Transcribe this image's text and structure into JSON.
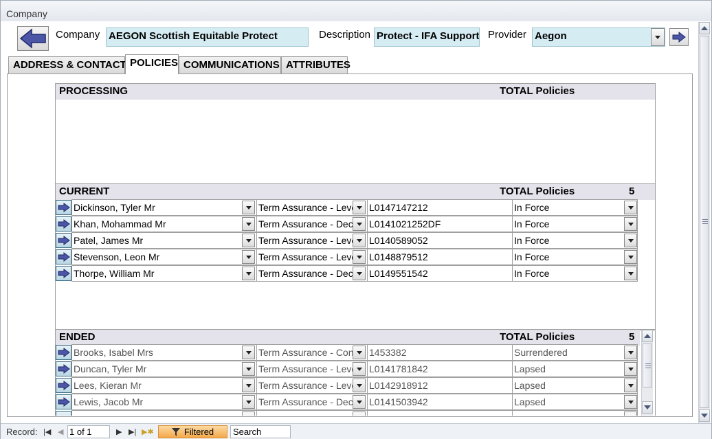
{
  "window": {
    "title": "Company"
  },
  "header": {
    "company_label": "Company",
    "company_value": "AEGON Scottish Equitable Protect",
    "description_label": "Description",
    "description_value": "Protect - IFA Support",
    "provider_label": "Provider",
    "provider_value": "Aegon"
  },
  "tabs": [
    {
      "label": "ADDRESS & CONTACTS",
      "active": false
    },
    {
      "label": "POLICIES",
      "active": true
    },
    {
      "label": "COMMUNICATIONS",
      "active": false
    },
    {
      "label": "ATTRIBUTES",
      "active": false
    }
  ],
  "processing": {
    "title": "PROCESSING",
    "total_label": "TOTAL Policies",
    "count": ""
  },
  "current": {
    "title": "CURRENT",
    "total_label": "TOTAL Policies",
    "count": "5",
    "rows": [
      {
        "name": "Dickinson, Tyler Mr",
        "product": "Term Assurance - Leve",
        "policy_no": "L0147147212",
        "status": "In Force"
      },
      {
        "name": "Khan, Mohammad Mr",
        "product": "Term Assurance - Decr",
        "policy_no": "L0141021252DF",
        "status": "In Force"
      },
      {
        "name": "Patel, James Mr",
        "product": "Term Assurance - Leve",
        "policy_no": "L0140589052",
        "status": "In Force"
      },
      {
        "name": "Stevenson, Leon Mr",
        "product": "Term Assurance - Leve",
        "policy_no": "L0148879512",
        "status": "In Force"
      },
      {
        "name": "Thorpe, William Mr",
        "product": "Term Assurance - Decr",
        "policy_no": "L0149551542",
        "status": "In Force"
      }
    ]
  },
  "ended": {
    "title": "ENDED",
    "total_label": "TOTAL Policies",
    "count": "5",
    "rows": [
      {
        "name": "Brooks, Isabel Mrs",
        "product": "Term Assurance - Conv",
        "policy_no": "1453382",
        "status": "Surrendered"
      },
      {
        "name": "Duncan, Tyler Mr",
        "product": "Term Assurance - Leve",
        "policy_no": "L0141781842",
        "status": "Lapsed"
      },
      {
        "name": "Lees, Kieran Mr",
        "product": "Term Assurance - Leve",
        "policy_no": "L0142918912",
        "status": "Lapsed"
      },
      {
        "name": "Lewis, Jacob Mr",
        "product": "Term Assurance - Decr",
        "policy_no": "L0141503942",
        "status": "Lapsed"
      }
    ]
  },
  "status_bar": {
    "record_label": "Record:",
    "record_value": "1 of 1",
    "filter_label": "Filtered",
    "search_label": "Search"
  },
  "icons": {
    "back": "back-arrow-icon",
    "go": "right-arrow-icon",
    "row_arrow": "row-arrow-icon",
    "dropdown": "chevron-down-icon",
    "filter": "funnel-icon"
  },
  "colors": {
    "field_bg": "#d6ecf3",
    "section_header_bg": "#e4e2ea",
    "filtered_bg": "#f4a84a",
    "arrow_icon": "#4b57a6"
  }
}
